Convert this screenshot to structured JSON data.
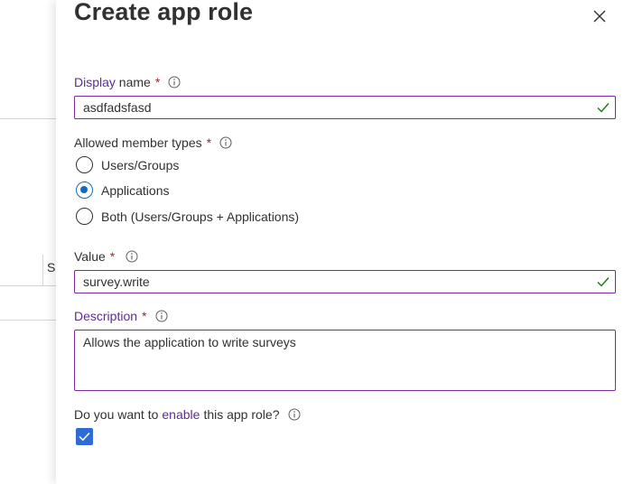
{
  "background": {
    "column_text": "S"
  },
  "panel": {
    "title": "Create app role",
    "display_name": {
      "label_highlight": "Display",
      "label_rest": " name",
      "required": "*",
      "value": "asdfadsfasd"
    },
    "member_types": {
      "label": "Allowed member types",
      "required": "*",
      "options": [
        {
          "label": "Users/Groups",
          "checked": false
        },
        {
          "label": "Applications",
          "checked": true
        },
        {
          "label": "Both (Users/Groups + Applications)",
          "checked": false
        }
      ]
    },
    "value_field": {
      "label": "Value",
      "required": "*",
      "value": "survey.write"
    },
    "description": {
      "label": "Description",
      "required": "*",
      "value": "Allows the application to write surveys"
    },
    "enable": {
      "label_before": "Do you want to",
      "label_link": "enable",
      "label_after": "this app role?",
      "checked": true
    }
  },
  "colors": {
    "accent_purple": "#5c2d91",
    "required_red": "#a4262c",
    "radio_blue": "#0f6cbd",
    "checkbox_blue": "#2f6bd6",
    "valid_green": "#107c10"
  }
}
